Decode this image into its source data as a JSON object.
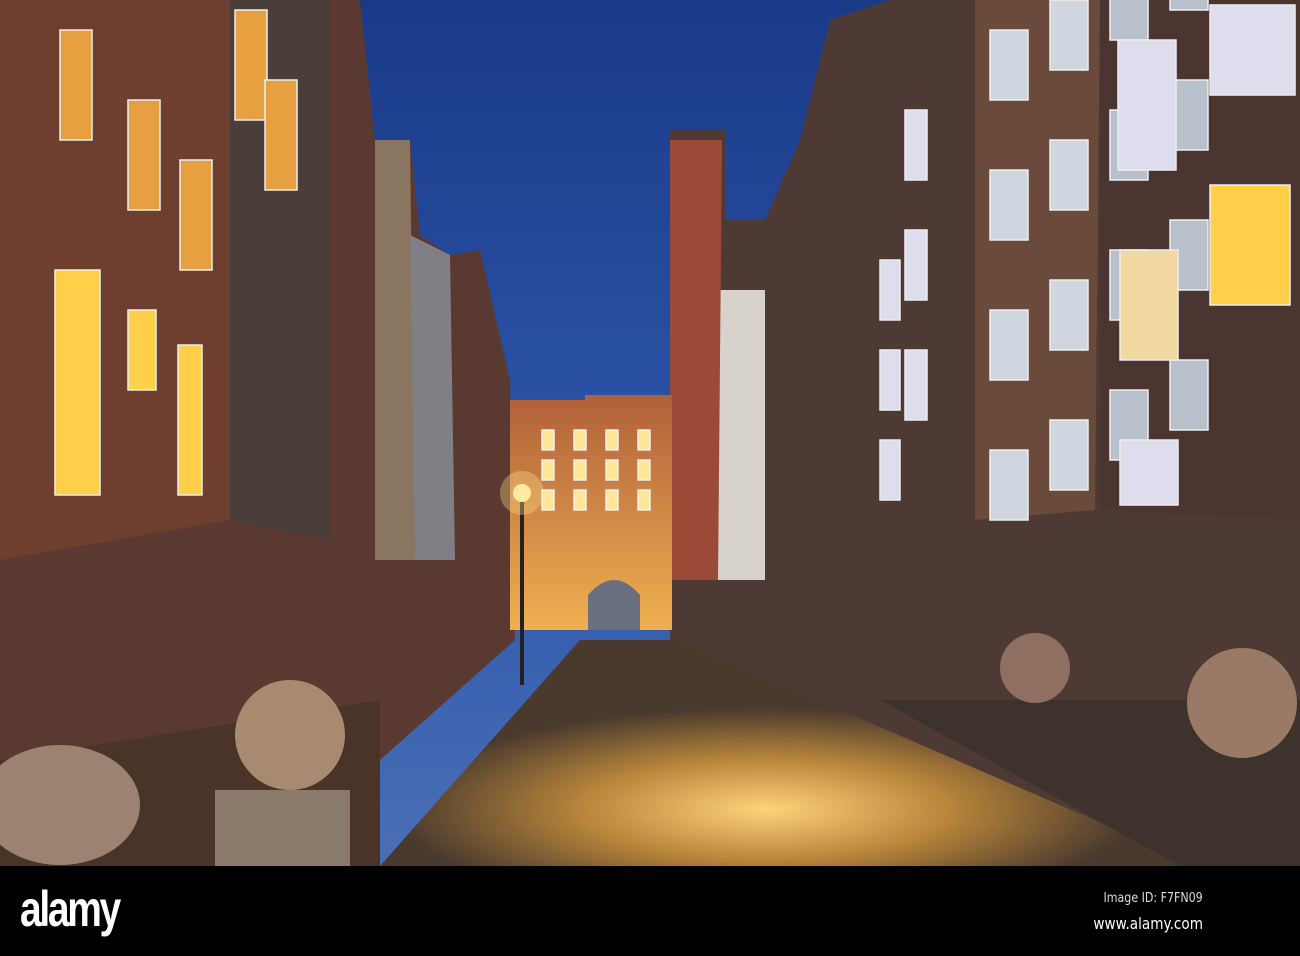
{
  "watermark": {
    "logo": "alamy",
    "image_id": "Image ID: F7FN09",
    "website": "www.alamy.com"
  },
  "colors": {
    "sky_top": "#1f3f8c",
    "sky_bottom": "#3b64b5",
    "window_glow": "#ffcf4a",
    "street": "#b8853a"
  }
}
